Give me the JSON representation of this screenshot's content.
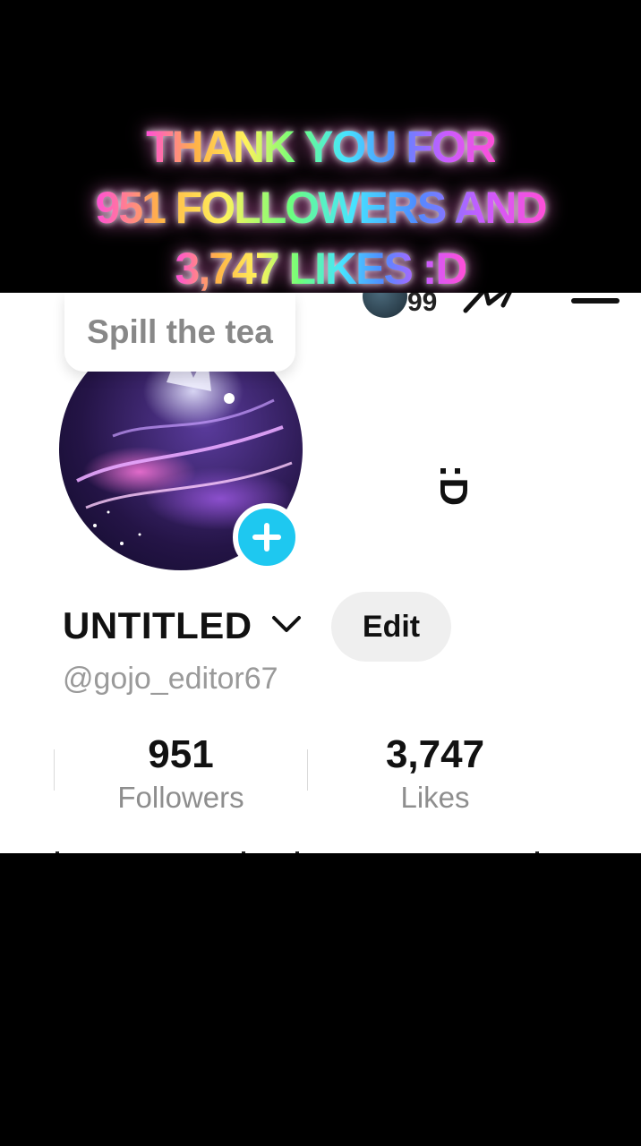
{
  "caption": {
    "line1": "THANK YOU FOR",
    "line2": "951 FOLLOWERS AND",
    "line3": "3,747 LIKES :D"
  },
  "header": {
    "badge_count": "99"
  },
  "bubble": {
    "text": "Spill the tea"
  },
  "decor": {
    "smiley": ":D"
  },
  "profile": {
    "display_name": "UNTITLED",
    "edit_label": "Edit",
    "handle": "@gojo_editor67"
  },
  "stats": {
    "followers_count": "951",
    "followers_label": "Followers",
    "likes_count": "3,747",
    "likes_label": "Likes"
  },
  "colors": {
    "accent_plus": "#1ec8f0",
    "edit_bg": "#efefef"
  }
}
